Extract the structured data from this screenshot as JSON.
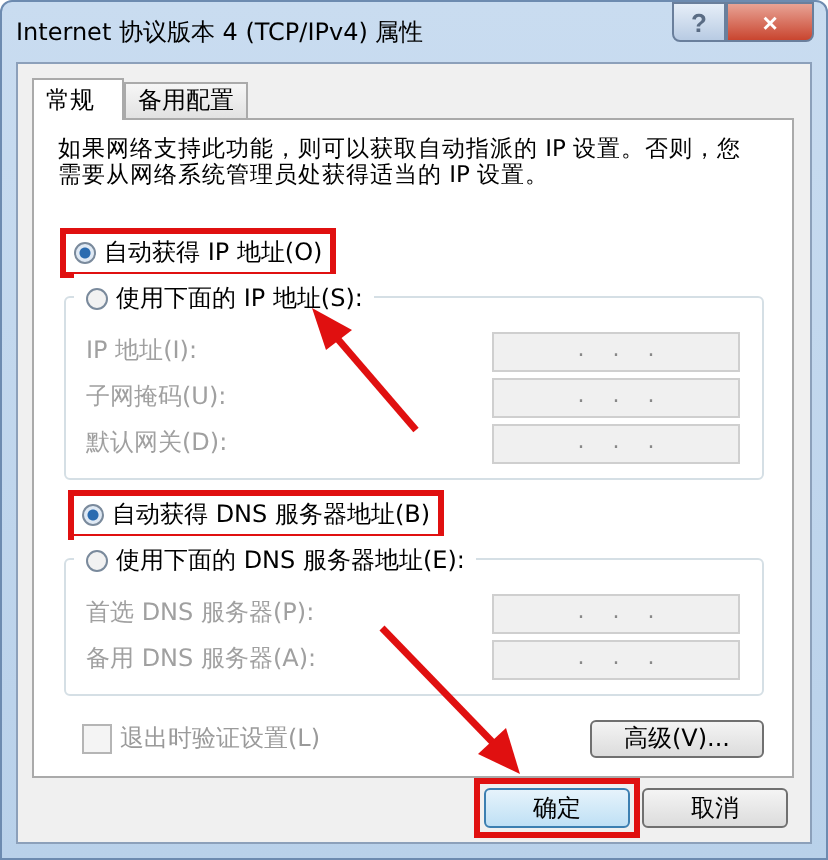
{
  "window": {
    "title": "Internet 协议版本 4 (TCP/IPv4) 属性",
    "help": "?",
    "close": "×"
  },
  "tabs": [
    {
      "label": "常规",
      "selected": true
    },
    {
      "label": "备用配置",
      "selected": false
    }
  ],
  "description": "如果网络支持此功能，则可以获取自动指派的 IP 设置。否则，您需要从网络系统管理员处获得适当的 IP 设置。",
  "ip": {
    "auto": {
      "label": "自动获得 IP 地址(O)",
      "selected": true,
      "highlighted": true
    },
    "manual": {
      "label": "使用下面的 IP 地址(S):",
      "selected": false,
      "highlighted": false
    },
    "fields": [
      {
        "label": "IP 地址(I):",
        "value": ".    .    .",
        "disabled": true
      },
      {
        "label": "子网掩码(U):",
        "value": ".    .    .",
        "disabled": true
      },
      {
        "label": "默认网关(D):",
        "value": ".    .    .",
        "disabled": true
      }
    ]
  },
  "dns": {
    "auto": {
      "label": "自动获得 DNS 服务器地址(B)",
      "selected": true,
      "highlighted": true
    },
    "manual": {
      "label": "使用下面的 DNS 服务器地址(E):",
      "selected": false,
      "highlighted": false
    },
    "fields": [
      {
        "label": "首选 DNS 服务器(P):",
        "value": ".    .    .",
        "disabled": true
      },
      {
        "label": "备用 DNS 服务器(A):",
        "value": ".    .    .",
        "disabled": true
      }
    ]
  },
  "validate": {
    "label": "退出时验证设置(L)",
    "checked": false,
    "disabled": true
  },
  "advanced_button": "高级(V)...",
  "buttons": [
    {
      "label": "确定",
      "default": true,
      "highlighted": true
    },
    {
      "label": "取消",
      "default": false,
      "highlighted": false
    }
  ]
}
